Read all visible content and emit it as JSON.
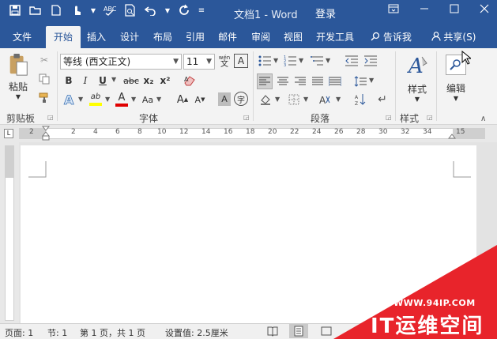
{
  "titlebar": {
    "doc_title": "文档1 - Word",
    "login": "登录",
    "qat_icons": [
      "save-icon",
      "open-icon",
      "new-icon",
      "touch-mode-icon",
      "spelling-icon",
      "print-preview-icon",
      "undo-icon",
      "redo-icon",
      "customize-icon"
    ],
    "window_buttons": [
      "ribbon-display-icon",
      "minimize-icon",
      "maximize-icon",
      "close-icon"
    ]
  },
  "tabs": [
    {
      "label": "文件"
    },
    {
      "label": "开始",
      "active": true
    },
    {
      "label": "插入"
    },
    {
      "label": "设计"
    },
    {
      "label": "布局"
    },
    {
      "label": "引用"
    },
    {
      "label": "邮件"
    },
    {
      "label": "审阅"
    },
    {
      "label": "视图"
    },
    {
      "label": "开发工具"
    }
  ],
  "tellme": "告诉我",
  "share": "共享(S)",
  "ribbon": {
    "clipboard": {
      "label": "剪贴板",
      "paste": "粘贴"
    },
    "font": {
      "label": "字体",
      "font_name": "等线 (西文正文)",
      "font_size": "11",
      "phonetic": "wén",
      "phonetic_char": "文",
      "format_buttons": [
        "B",
        "I",
        "U",
        "abc",
        "x₂",
        "x²"
      ],
      "highlight": "ab",
      "color_letter": "A",
      "size_letter": "Aa",
      "grow_letter": "A",
      "shrink_letter": "A",
      "shade_letter": "A",
      "enclose_char": "字"
    },
    "paragraph": {
      "label": "段落"
    },
    "styles": {
      "label": "样式",
      "button": "样式"
    },
    "editing": {
      "button": "编辑"
    }
  },
  "ruler_numbers": [
    "2",
    "2",
    "4",
    "6",
    "8",
    "10",
    "12",
    "14",
    "16",
    "18",
    "20",
    "22",
    "24",
    "26",
    "28",
    "30",
    "32",
    "34",
    "36",
    "38",
    "15"
  ],
  "status": {
    "page": "页面: 1",
    "section": "节: 1",
    "page_of": "第 1 页，共 1 页",
    "setting": "设置值: 2.5厘米"
  },
  "watermark": {
    "url": "WWW.94IP.COM",
    "brand": "IT运维空间",
    "color": "#e8242b"
  },
  "colors": {
    "brand_blue": "#2b579a",
    "highlight_yellow": "#ffff00",
    "font_color_red": "#e00000"
  }
}
